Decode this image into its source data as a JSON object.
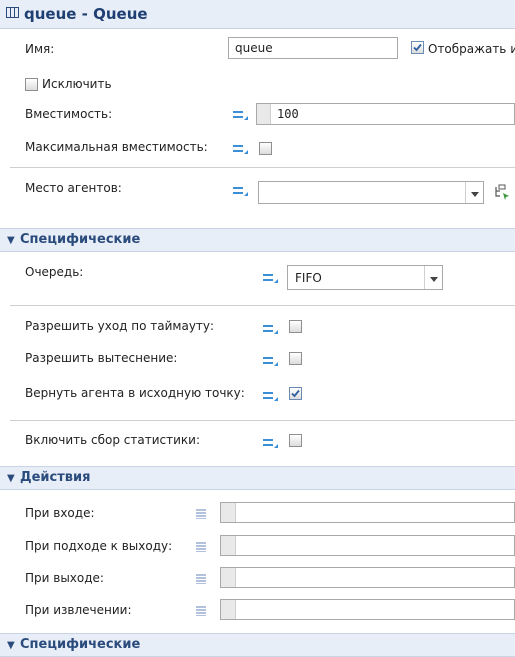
{
  "header": {
    "title": "queue - Queue"
  },
  "general": {
    "name_label": "Имя:",
    "name_value": "queue",
    "show_name_label": "Отображать и",
    "exclude_label": "Исключить",
    "capacity_label": "Вместимость:",
    "capacity_value": "100",
    "max_capacity_label": "Максимальная вместимость:",
    "agent_location_label": "Место агентов:"
  },
  "specific": {
    "section_title": "Специфические",
    "queue_label": "Очередь:",
    "queue_value": "FIFO",
    "timeout_label": "Разрешить уход по таймауту:",
    "preemption_label": "Разрешить вытеснение:",
    "return_label": "Вернуть агента в исходную точку:",
    "stats_label": "Включить сбор статистики:"
  },
  "actions": {
    "section_title": "Действия",
    "on_enter_label": "При входе:",
    "on_exit_approach_label": "При подходе к выходу:",
    "on_exit_label": "При выходе:",
    "on_remove_label": "При извлечении:"
  },
  "bottom_section": {
    "section_title": "Специфические"
  },
  "colors": {
    "accent": "#2a4b7c",
    "section_bg": "#e7eef7",
    "dyn_icon": "#3a8fd6"
  }
}
